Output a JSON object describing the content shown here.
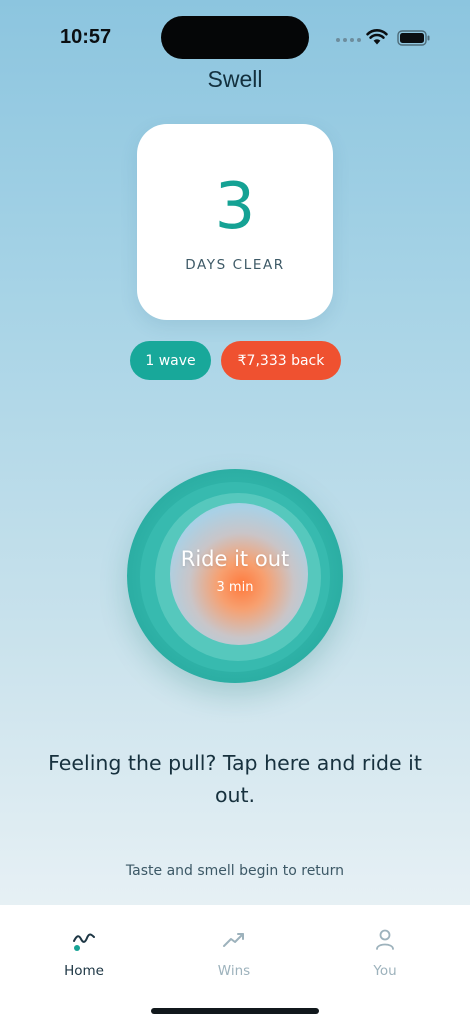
{
  "status_bar": {
    "time": "10:57"
  },
  "app": {
    "title": "Swell"
  },
  "streak": {
    "count": "3",
    "label": "DAYS CLEAR"
  },
  "chips": {
    "waves": "1 wave",
    "savings": "₹7,333 back"
  },
  "ride_button": {
    "title": "Ride it out",
    "duration": "3 min"
  },
  "prompt": "Feeling the pull? Tap here and ride it out.",
  "milestone": "Taste and smell begin to return",
  "tabs": [
    {
      "label": "Home",
      "icon": "wave-icon",
      "active": true
    },
    {
      "label": "Wins",
      "icon": "trend-up-icon",
      "active": false
    },
    {
      "label": "You",
      "icon": "person-icon",
      "active": false
    }
  ],
  "colors": {
    "accent_teal": "#18a89a",
    "accent_orange": "#ef5130",
    "text_dark": "#17313e"
  }
}
